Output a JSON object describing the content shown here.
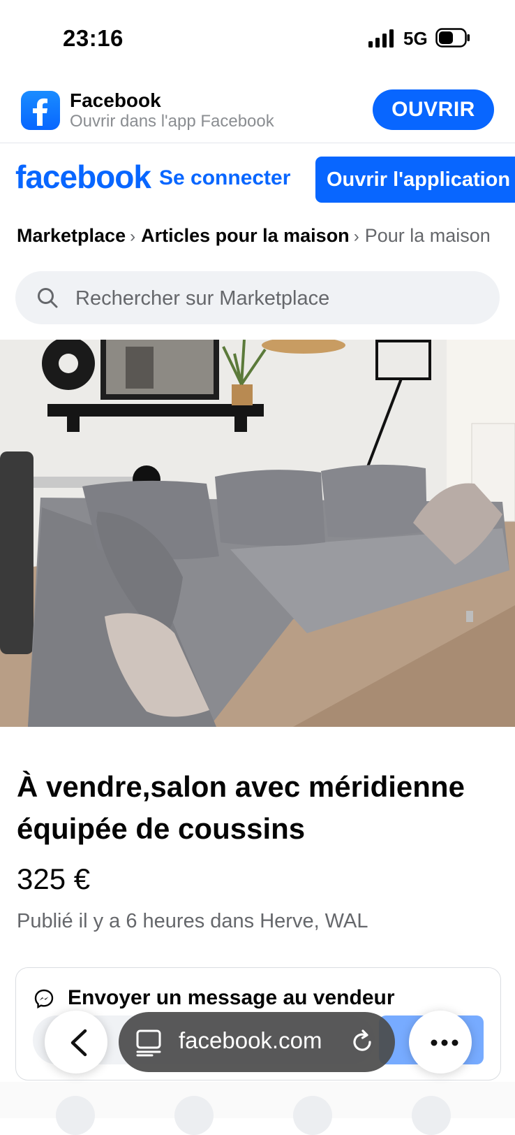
{
  "status_bar": {
    "time": "23:16",
    "network": "5G"
  },
  "app_banner": {
    "app_name": "Facebook",
    "subtitle": "Ouvrir dans l'app Facebook",
    "open_label": "OUVRIR"
  },
  "header": {
    "wordmark": "facebook",
    "login_label": "Se connecter",
    "open_app_label": "Ouvrir l'application"
  },
  "breadcrumb": {
    "items": [
      "Marketplace",
      "Articles pour la maison"
    ],
    "current": "Pour la maison"
  },
  "search": {
    "placeholder": "Rechercher sur Marketplace"
  },
  "listing": {
    "title": "À vendre,salon avec méridienne équipée de coussins",
    "price": "325 €",
    "posted": "Publié il y a 6 heures dans Herve, WAL"
  },
  "message_card": {
    "title": "Envoyer un message au vendeur"
  },
  "browser": {
    "url": "facebook.com"
  },
  "colors": {
    "brand_blue": "#0866ff",
    "secondary_text": "#65676b",
    "surface": "#f0f2f5"
  }
}
